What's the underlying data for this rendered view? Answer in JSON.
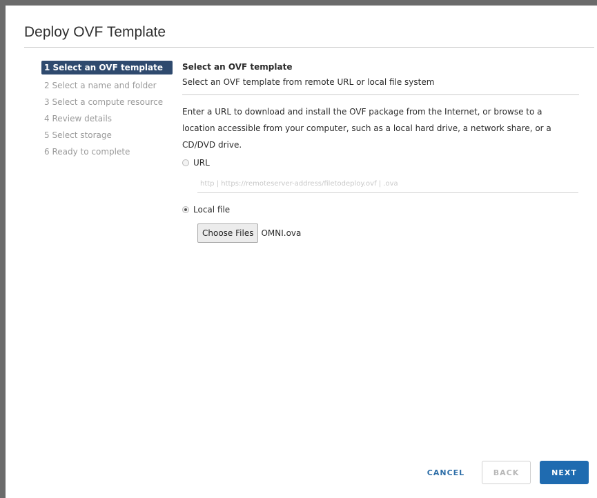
{
  "dialog": {
    "title": "Deploy OVF Template"
  },
  "steps": [
    {
      "label": "1 Select an OVF template",
      "active": true
    },
    {
      "label": "2 Select a name and folder",
      "active": false
    },
    {
      "label": "3 Select a compute resource",
      "active": false
    },
    {
      "label": "4 Review details",
      "active": false
    },
    {
      "label": "5 Select storage",
      "active": false
    },
    {
      "label": "6 Ready to complete",
      "active": false
    }
  ],
  "content": {
    "heading": "Select an OVF template",
    "subheading": "Select an OVF template from remote URL or local file system",
    "description": "Enter a URL to download and install the OVF package from the Internet, or browse to a location accessible from your computer, such as a local hard drive, a network share, or a CD/DVD drive.",
    "url_option": {
      "label": "URL",
      "selected": false
    },
    "url_placeholder": "http | https://remoteserver-address/filetodeploy.ovf | .ova",
    "local_option": {
      "label": "Local file",
      "selected": true
    },
    "choose_files_label": "Choose Files",
    "file_name": "OMNI.ova"
  },
  "footer": {
    "cancel_label": "CANCEL",
    "back_label": "BACK",
    "next_label": "NEXT"
  },
  "colors": {
    "active_step_bg": "#2f4a6e",
    "primary_button": "#1f6bb0",
    "link": "#2f6fa8"
  }
}
